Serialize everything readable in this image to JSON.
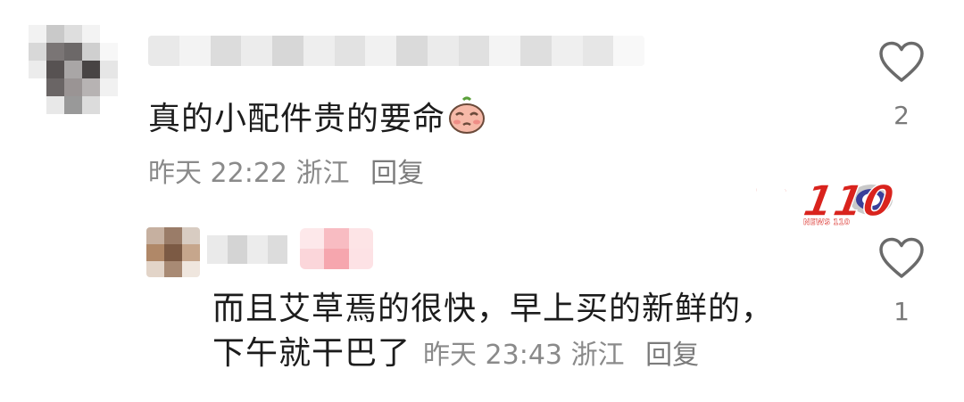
{
  "comments": [
    {
      "text": "真的小配件贵的要命",
      "emoji": "pouting-face-emoji",
      "time": "昨天 22:22",
      "location": "浙江",
      "reply_label": "回复",
      "like_count": "2"
    }
  ],
  "reply": {
    "text_line1": "而且艾草焉的很快，早上买的新鲜的，",
    "text_line2": "下午就干巴了",
    "time": "昨天 23:43",
    "location": "浙江",
    "reply_label": "回复",
    "like_count": "1"
  },
  "watermark": {
    "logo_text": "新闻110",
    "sub_text": "NEWS 110"
  },
  "colors": {
    "text_primary": "#1c1c1c",
    "text_meta": "#8a8a8a",
    "logo_red": "#d9231d"
  }
}
